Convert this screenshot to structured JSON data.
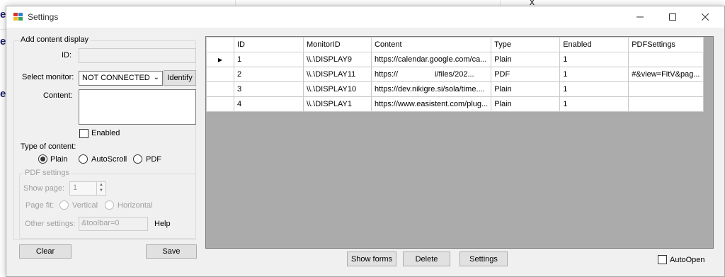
{
  "window": {
    "title": "Settings"
  },
  "background": {
    "frag1": "e,",
    "frag2": "e",
    "frag3": "e",
    "frag4": "x"
  },
  "left_panel": {
    "group_title": "Add content display",
    "id_label": "ID:",
    "id_value": "",
    "monitor_label": "Select monitor:",
    "monitor_value": "NOT CONNECTED",
    "identify_button": "Identify",
    "content_label": "Content:",
    "content_value": "",
    "enabled_label": "Enabled",
    "enabled_checked": false,
    "type_label": "Type of content:",
    "type_options": [
      "Plain",
      "AutoScroll",
      "PDF"
    ],
    "type_selected": "Plain",
    "pdf_group_title": "PDF settings",
    "show_page_label": "Show page:",
    "show_page_value": "1",
    "page_fit_label": "Page fit:",
    "page_fit_options": [
      "Vertical",
      "Horizontal"
    ],
    "other_settings_label": "Other settings:",
    "other_settings_value": "&toolbar=0",
    "help_label": "Help",
    "clear_button": "Clear",
    "save_button": "Save"
  },
  "grid": {
    "columns": [
      "ID",
      "MonitorID",
      "Content",
      "Type",
      "Enabled",
      "PDFSettings"
    ],
    "rows": [
      [
        "1",
        "\\\\.\\DISPLAY9",
        "https://calendar.google.com/ca...",
        "Plain",
        "1",
        ""
      ],
      [
        "2",
        "\\\\.\\DISPLAY11",
        "https://                 i/files/202...",
        "PDF",
        "1",
        "#&view=FitV&pag..."
      ],
      [
        "3",
        "\\\\.\\DISPLAY10",
        "https://dev.nikigre.si/sola/time....",
        "Plain",
        "1",
        ""
      ],
      [
        "4",
        "\\\\.\\DISPLAY1",
        "https://www.easistent.com/plug...",
        "Plain",
        "1",
        ""
      ]
    ],
    "selected_row": 0
  },
  "bottom": {
    "show_forms_button": "Show forms",
    "delete_button": "Delete",
    "settings_button": "Settings",
    "autoopen_label": "AutoOpen",
    "autoopen_checked": false
  },
  "icons": {
    "app": "settings-app-icon",
    "minimize": "minimize-icon",
    "maximize": "maximize-icon",
    "close": "close-icon",
    "dropdown": "chevron-down-icon",
    "row_selector": "row-selector-arrow-icon"
  },
  "colors": {
    "window_bg": "#f0f0f0",
    "grid_bg": "#ababab",
    "button_bg": "#e1e1e1"
  }
}
